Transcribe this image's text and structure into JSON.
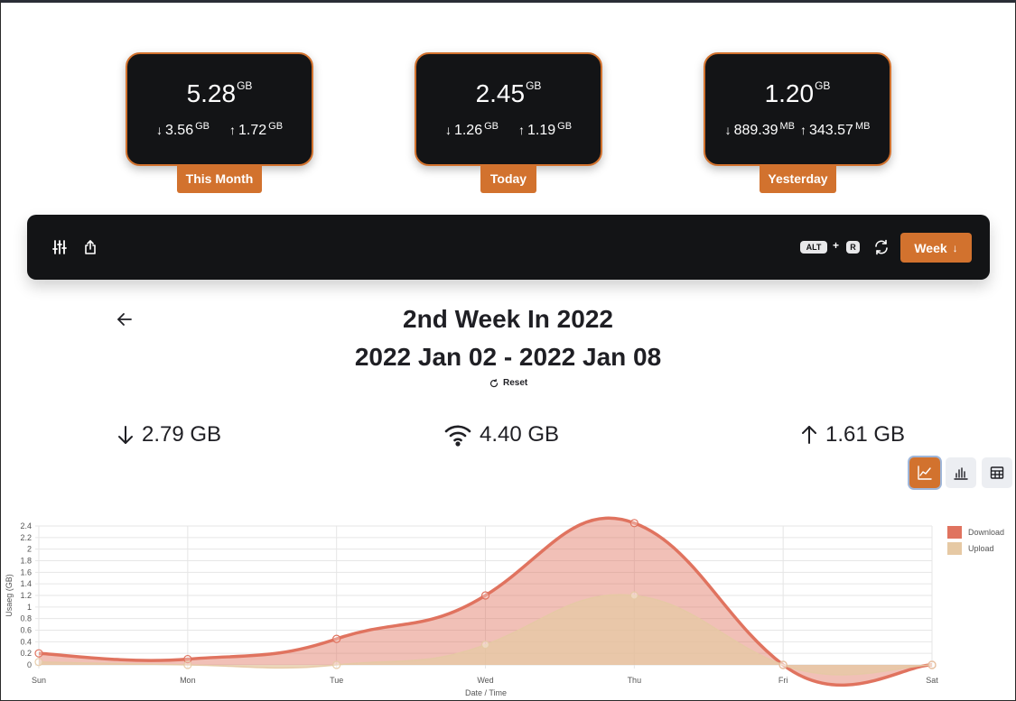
{
  "cards": [
    {
      "id": "month",
      "total": "5.28",
      "total_unit": "GB",
      "down": "3.56",
      "down_unit": "GB",
      "up": "1.72",
      "up_unit": "GB",
      "label": "This Month"
    },
    {
      "id": "today",
      "total": "2.45",
      "total_unit": "GB",
      "down": "1.26",
      "down_unit": "GB",
      "up": "1.19",
      "up_unit": "GB",
      "label": "Today"
    },
    {
      "id": "yesterday",
      "total": "1.20",
      "total_unit": "GB",
      "down": "889.39",
      "down_unit": "MB",
      "up": "343.57",
      "up_unit": "MB",
      "label": "Yesterday"
    }
  ],
  "toolbar": {
    "filters_icon": "sliders-icon",
    "export_icon": "share-icon",
    "shortcut_key1": "ALT",
    "shortcut_plus": "+",
    "shortcut_key2": "R",
    "refresh_icon": "refresh-icon",
    "period_label": "Week"
  },
  "period": {
    "title": "2nd Week In 2022",
    "range": "2022 Jan 02 - 2022 Jan 08",
    "reset_label": "Reset"
  },
  "summary": {
    "download": "2.79 GB",
    "total": "4.40 GB",
    "upload": "1.61 GB"
  },
  "view_buttons": [
    "line-chart-icon",
    "bar-chart-icon",
    "table-icon"
  ],
  "colors": {
    "accent": "#d2722e",
    "dark": "#131416",
    "download": "#e0735f",
    "upload": "#e6c9a4"
  },
  "chart_data": {
    "type": "area",
    "categories": [
      "Sun",
      "Mon",
      "Tue",
      "Wed",
      "Thu",
      "Fri",
      "Sat"
    ],
    "series": [
      {
        "name": "Download",
        "values": [
          0.2,
          0.1,
          0.45,
          1.2,
          2.45,
          0,
          0
        ]
      },
      {
        "name": "Upload",
        "values": [
          0.05,
          0,
          0,
          0.35,
          1.2,
          0,
          0
        ]
      }
    ],
    "xlabel": "Date / Time",
    "ylabel": "Usaeg (GB)",
    "yticks": [
      "0",
      "0.2",
      "0.4",
      "0.6",
      "0.8",
      "1",
      "1.2",
      "1.4",
      "1.6",
      "1.8",
      "2",
      "2.2",
      "2.4"
    ],
    "ylim": [
      0,
      2.4
    ],
    "grid": true,
    "legend": "top-right"
  }
}
